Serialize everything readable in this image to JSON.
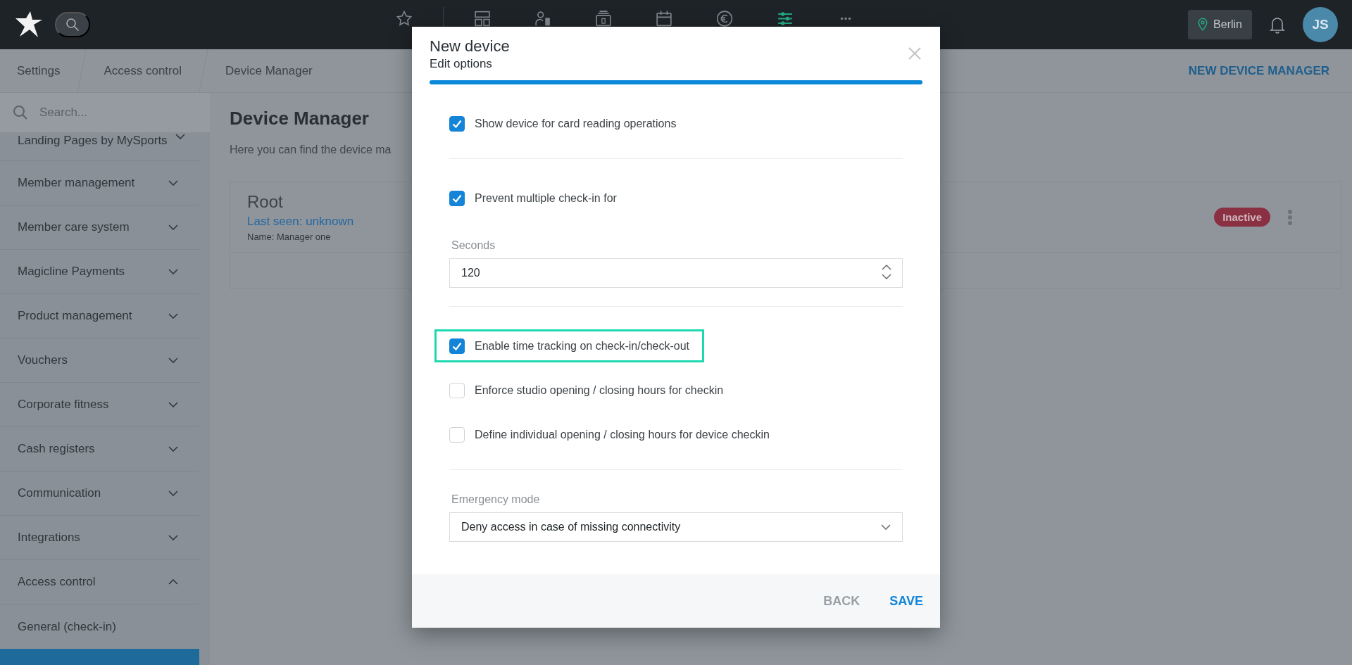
{
  "header": {
    "nav": [
      {
        "selected": false
      },
      {
        "selected": false
      },
      {
        "selected": false
      },
      {
        "selected": false
      },
      {
        "selected": false
      },
      {
        "selected": false
      },
      {
        "selected": true
      },
      {
        "selected": false
      }
    ],
    "location": "Berlin",
    "avatar": "JS"
  },
  "breadcrumbs": [
    "Settings",
    "Access control",
    "Device Manager"
  ],
  "page_action": "NEW DEVICE MANAGER",
  "sidebar": {
    "search": {
      "placeholder": "Search..."
    },
    "items": [
      {
        "label": "Landing Pages by MySports",
        "expanded": false
      },
      {
        "label": "Member management",
        "expanded": false
      },
      {
        "label": "Member care system",
        "expanded": false
      },
      {
        "label": "Magicline Payments",
        "expanded": false
      },
      {
        "label": "Product management",
        "expanded": false
      },
      {
        "label": "Vouchers",
        "expanded": false
      },
      {
        "label": "Corporate fitness",
        "expanded": false
      },
      {
        "label": "Cash registers",
        "expanded": false
      },
      {
        "label": "Communication",
        "expanded": false
      },
      {
        "label": "Integrations",
        "expanded": false
      },
      {
        "label": "Access control",
        "expanded": true,
        "children": [
          {
            "label": "General (check-in)",
            "selected": false
          },
          {
            "selected": true
          }
        ]
      }
    ]
  },
  "main": {
    "title": "Device Manager",
    "description": "Here you can find the device ma",
    "devices": [
      {
        "name": "Root",
        "last_seen": "Last seen: unknown",
        "detail": "Name: Manager one",
        "status": "Inactive"
      }
    ]
  },
  "dialog": {
    "title": "New device",
    "subtitle": "Edit options",
    "progress": {
      "level": 1
    },
    "sections": [
      {
        "fields": [
          {
            "kind": "checkbox",
            "label": "Show device for card reading operations",
            "checked": true,
            "highlighted": false
          }
        ]
      },
      {
        "fields": [
          {
            "kind": "checkbox",
            "label": "Prevent multiple check-in for",
            "checked": true,
            "highlighted": false
          },
          {
            "kind": "number",
            "label": "Seconds",
            "value": "120"
          }
        ]
      },
      {
        "fields": [
          {
            "kind": "checkbox",
            "label": "Enable time tracking on check-in/check-out",
            "checked": true,
            "highlighted": true
          },
          {
            "kind": "checkbox",
            "label": "Enforce studio opening / closing hours for checkin",
            "checked": false,
            "highlighted": false
          },
          {
            "kind": "checkbox",
            "label": "Define individual opening / closing hours for device checkin",
            "checked": false,
            "highlighted": false
          }
        ]
      },
      {
        "fields": [
          {
            "kind": "select",
            "label": "Emergency mode",
            "value": "Deny access in case of missing connectivity"
          }
        ]
      }
    ],
    "buttons": [
      {
        "label": "BACK",
        "kind": "secondary"
      },
      {
        "label": "SAVE",
        "kind": "primary"
      }
    ]
  }
}
